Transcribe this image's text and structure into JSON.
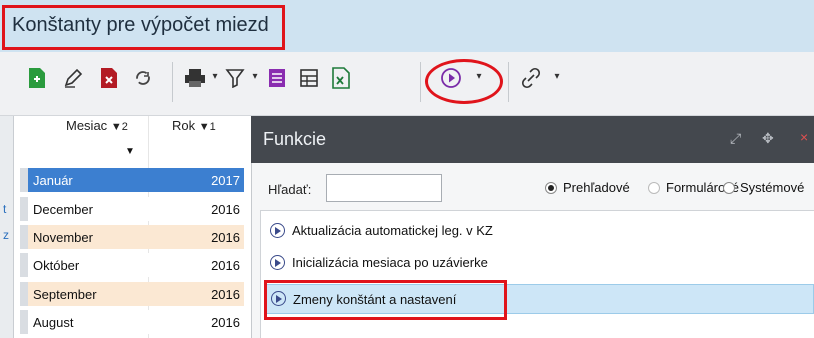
{
  "window": {
    "title": "Konštanty pre výpočet miezd"
  },
  "toolbar": {
    "icons": [
      "new-document-icon",
      "edit-pen-icon",
      "delete-icon",
      "refresh-icon",
      "print-icon",
      "filter-icon",
      "list-icon",
      "table-icon",
      "excel-export-icon",
      "play-icon",
      "link-icon"
    ],
    "dropdown_glyph": "▾"
  },
  "left_strip": {
    "chars": [
      "t",
      "z"
    ]
  },
  "grid": {
    "columns": [
      {
        "label": "Mesiac",
        "sort": "▼2"
      },
      {
        "label": "Rok",
        "sort": "▼1"
      }
    ],
    "filter_glyph": "▼",
    "rows": [
      {
        "month": "Január",
        "year": "2017",
        "selected": true
      },
      {
        "month": "December",
        "year": "2016"
      },
      {
        "month": "November",
        "year": "2016"
      },
      {
        "month": "Október",
        "year": "2016"
      },
      {
        "month": "September",
        "year": "2016"
      },
      {
        "month": "August",
        "year": "2016"
      }
    ]
  },
  "panel": {
    "title": "Funkcie",
    "search_label": "Hľadať:",
    "search_value": "",
    "radios": [
      {
        "label": "Prehľadové",
        "checked": true
      },
      {
        "label": "Formulárové",
        "checked": false
      },
      {
        "label": "Systémové",
        "checked": false
      }
    ],
    "items": [
      {
        "label": "Aktualizácia automatickej leg. v KZ"
      },
      {
        "label": "Inicializácia mesiaca po uzávierke"
      },
      {
        "label": "Zmeny konštánt a nastavení",
        "selected": true
      }
    ],
    "controls": [
      "⤢",
      "✥",
      "×"
    ]
  },
  "colors": {
    "highlight": "#e0141b",
    "selection": "#3c7fd0",
    "alt_row": "#fbe8d3",
    "panel_header": "#44484e"
  }
}
